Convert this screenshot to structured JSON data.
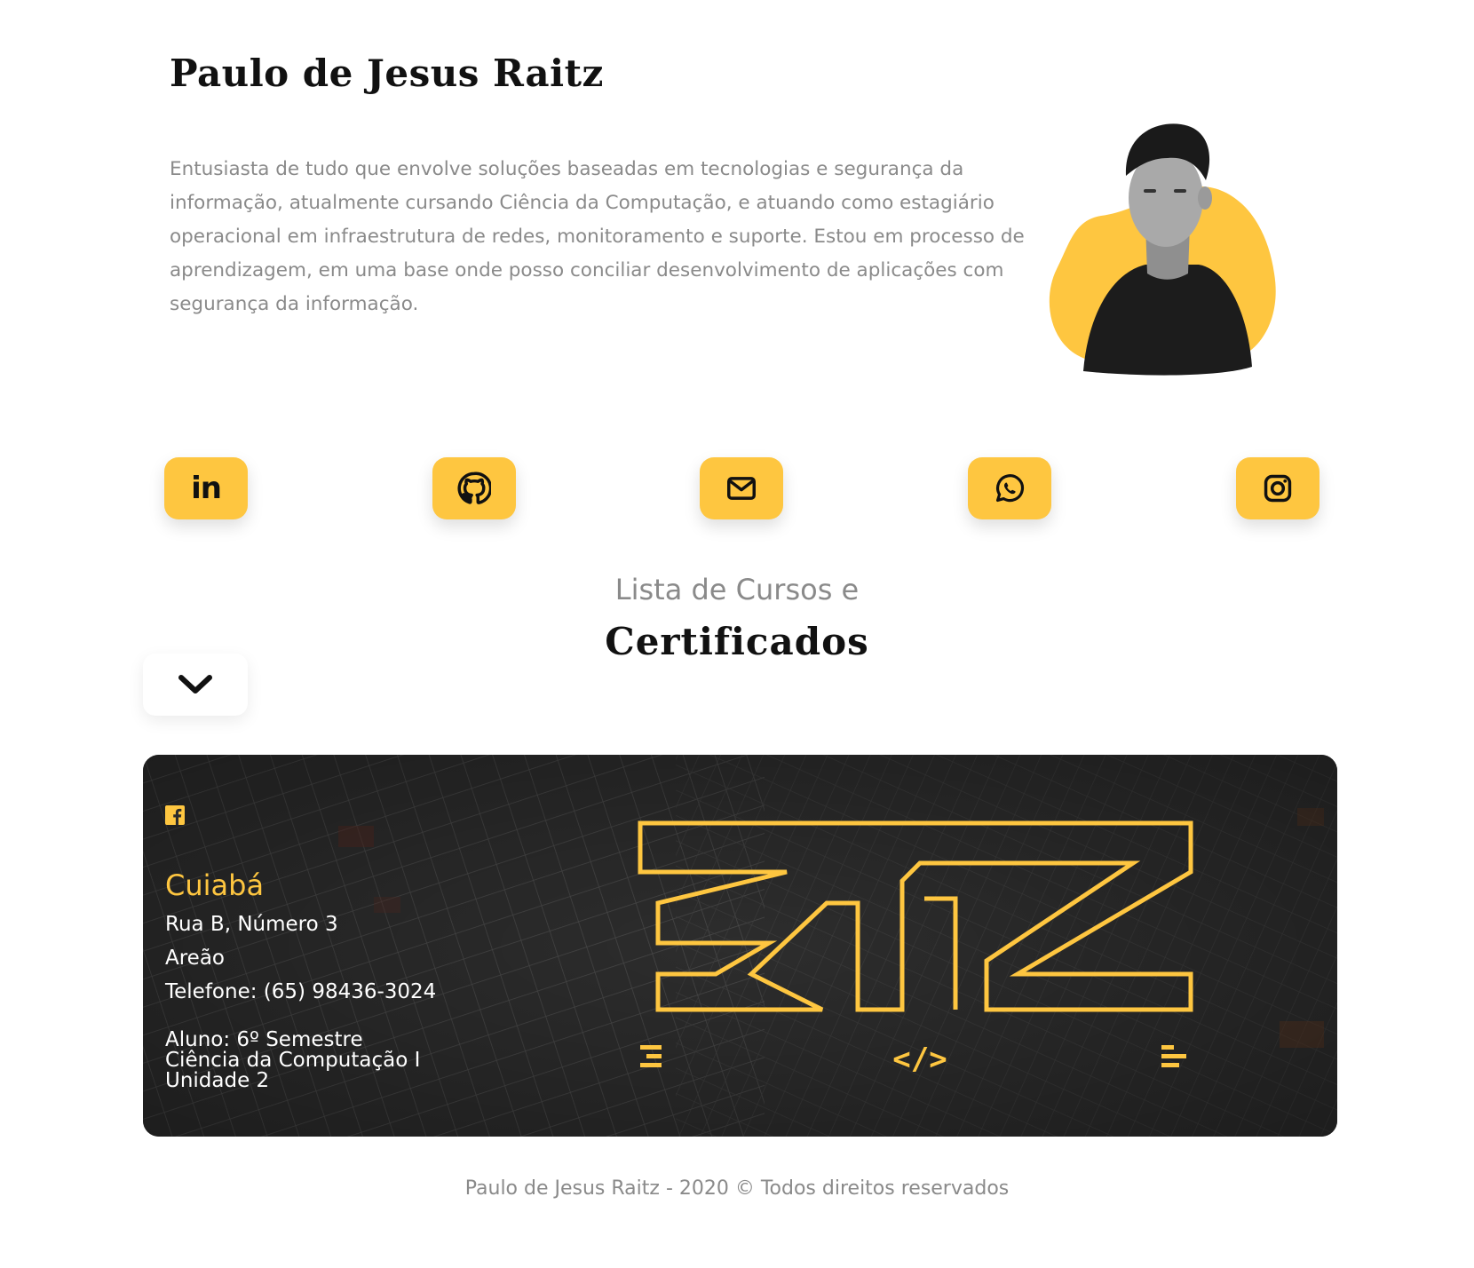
{
  "profile": {
    "name": "Paulo de Jesus Raitz",
    "bio": "Entusiasta de tudo que envolve soluções baseadas em tecnologias e segurança da informação, atualmente cursando Ciência da Computação, e atuando como estagiário operacional em infraestrutura de redes, monitoramento e suporte. Estou em processo de aprendizagem, em uma base onde posso conciliar desenvolvimento de aplicações com segurança da informação."
  },
  "socials": {
    "linkedin_label": "in",
    "icons": [
      "linkedin-icon",
      "github-icon",
      "mail-icon",
      "whatsapp-icon",
      "instagram-icon"
    ]
  },
  "courses": {
    "subtitle": "Lista de Cursos e",
    "title": "Certificados"
  },
  "footer": {
    "city": "Cuiabá",
    "street": "Rua B, Número 3",
    "district": "Areão",
    "phone": "Telefone: (65) 98436-3024",
    "student_line1": "Aluno: 6º Semestre",
    "student_line2": "Ciência da Computação I",
    "student_line3": "Unidade 2",
    "logo_code": "</>"
  },
  "copyright": "Paulo de Jesus Raitz - 2020 © Todos direitos reservados",
  "colors": {
    "accent": "#fec640",
    "dark": "#111111",
    "muted": "#8a8a8a",
    "card_bg": "#2b2b2b"
  }
}
